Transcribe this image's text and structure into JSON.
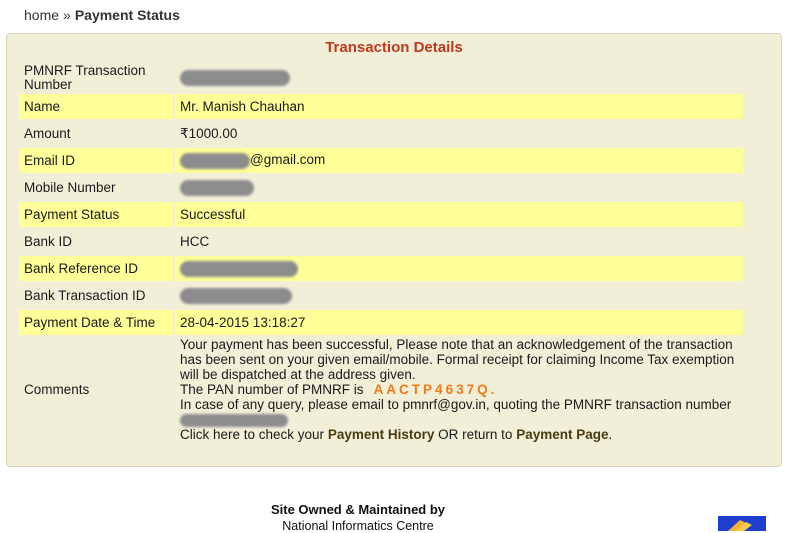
{
  "breadcrumb": {
    "home": "home",
    "separator": "»",
    "current": "Payment Status"
  },
  "panel": {
    "title": "Transaction Details"
  },
  "rows": [
    {
      "label": "PMNRF Transaction Number",
      "value": ""
    },
    {
      "label": "Name",
      "value": "Mr. Manish Chauhan"
    },
    {
      "label": "Amount",
      "value": "₹1000.00"
    },
    {
      "label": "Email ID",
      "value": "@gmail.com"
    },
    {
      "label": "Mobile Number",
      "value": ""
    },
    {
      "label": "Payment Status",
      "value": "Successful"
    },
    {
      "label": "Bank ID",
      "value": "HCC"
    },
    {
      "label": "Bank Reference ID",
      "value": ""
    },
    {
      "label": "Bank Transaction ID",
      "value": ""
    },
    {
      "label": "Payment Date & Time",
      "value": "28-04-2015 13:18:27"
    }
  ],
  "comments": {
    "label": "Comments",
    "line1": "Your payment has been successful, Please note that an acknowledgement of the transaction has been sent on your given email/mobile. Formal receipt for claiming Income Tax exemption will be dispatched at the address given.",
    "pan_prefix": "The PAN number of PMNRF is",
    "pan": "AACTP4637Q.",
    "query": "In case of any query, please email to pmnrf@gov.in, quoting the PMNRF transaction number",
    "click_prefix": "Click here to check your",
    "payment_history": "Payment History",
    "or_return": "OR return to",
    "payment_page": "Payment Page",
    "end": "."
  },
  "footer": {
    "owned": "Site Owned & Maintained by",
    "nic": "National Informatics Centre"
  },
  "colors": {
    "title": "#c0391b",
    "highlight": "#ffff99",
    "panel": "#f2efd9",
    "pan": "#f07a1a",
    "badge": "#1e3fcc"
  }
}
